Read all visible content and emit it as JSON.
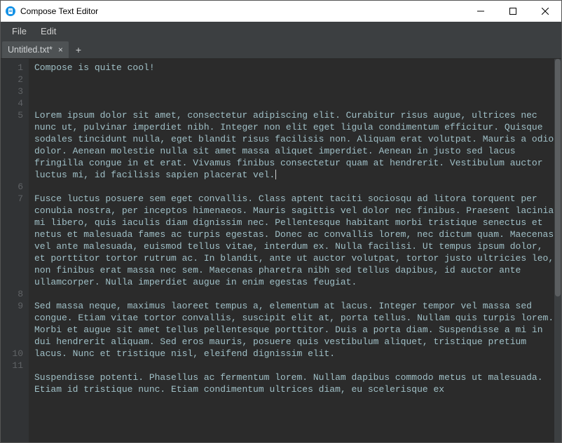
{
  "window": {
    "title": "Compose Text Editor"
  },
  "menubar": {
    "items": [
      "File",
      "Edit"
    ]
  },
  "tabs": {
    "items": [
      {
        "label": "Untitled.txt*"
      }
    ],
    "new_tab_label": "+"
  },
  "editor": {
    "gutter_numbers": [
      "1",
      "2",
      "3",
      "4",
      "5",
      "",
      "",
      "",
      "",
      "",
      "6",
      "7",
      "",
      "",
      "",
      "",
      "",
      "",
      "",
      "8",
      "9",
      "",
      "",
      "",
      "10",
      "11",
      ""
    ],
    "paragraphs": [
      "Compose is quite cool!",
      "",
      "",
      "",
      "Lorem ipsum dolor sit amet, consectetur adipiscing elit. Curabitur risus augue, ultrices nec nunc ut, pulvinar imperdiet nibh. Integer non elit eget ligula condimentum efficitur. Quisque sodales tincidunt nulla, eget blandit risus facilisis non. Aliquam erat volutpat. Mauris a odio dolor. Aenean molestie nulla sit amet massa aliquet imperdiet. Aenean in justo sed lacus fringilla congue in et erat. Vivamus finibus consectetur quam at hendrerit. Vestibulum auctor luctus mi, id facilisis sapien placerat vel.",
      "",
      "Fusce luctus posuere sem eget convallis. Class aptent taciti sociosqu ad litora torquent per conubia nostra, per inceptos himenaeos. Mauris sagittis vel dolor nec finibus. Praesent lacinia mi libero, quis iaculis diam dignissim nec. Pellentesque habitant morbi tristique senectus et netus et malesuada fames ac turpis egestas. Donec ac convallis lorem, nec dictum quam. Maecenas vel ante malesuada, euismod tellus vitae, interdum ex. Nulla facilisi. Ut tempus ipsum dolor, et porttitor tortor rutrum ac. In blandit, ante ut auctor volutpat, tortor justo ultricies leo, non finibus erat massa nec sem. Maecenas pharetra nibh sed tellus dapibus, id auctor ante ullamcorper. Nulla imperdiet augue in enim egestas feugiat.",
      "",
      "Sed massa neque, maximus laoreet tempus a, elementum at lacus. Integer tempor vel massa sed congue. Etiam vitae tortor convallis, suscipit elit at, porta tellus. Nullam quis turpis lorem. Morbi et augue sit amet tellus pellentesque porttitor. Duis a porta diam. Suspendisse a mi in dui hendrerit aliquam. Sed eros mauris, posuere quis vestibulum aliquet, tristique pretium lacus. Nunc et tristique nisl, eleifend dignissim elit.",
      "",
      "Suspendisse potenti. Phasellus ac fermentum lorem. Nullam dapibus commodo metus ut malesuada. Etiam id tristique nunc. Etiam condimentum ultrices diam, eu scelerisque ex"
    ],
    "cursor_paragraph_index": 4
  },
  "scrollbar": {
    "thumb_top_pct": 0,
    "thumb_height_pct": 62
  },
  "icons": {
    "app": "document-icon",
    "minimize": "minimize-icon",
    "maximize": "maximize-icon",
    "close": "close-icon"
  }
}
